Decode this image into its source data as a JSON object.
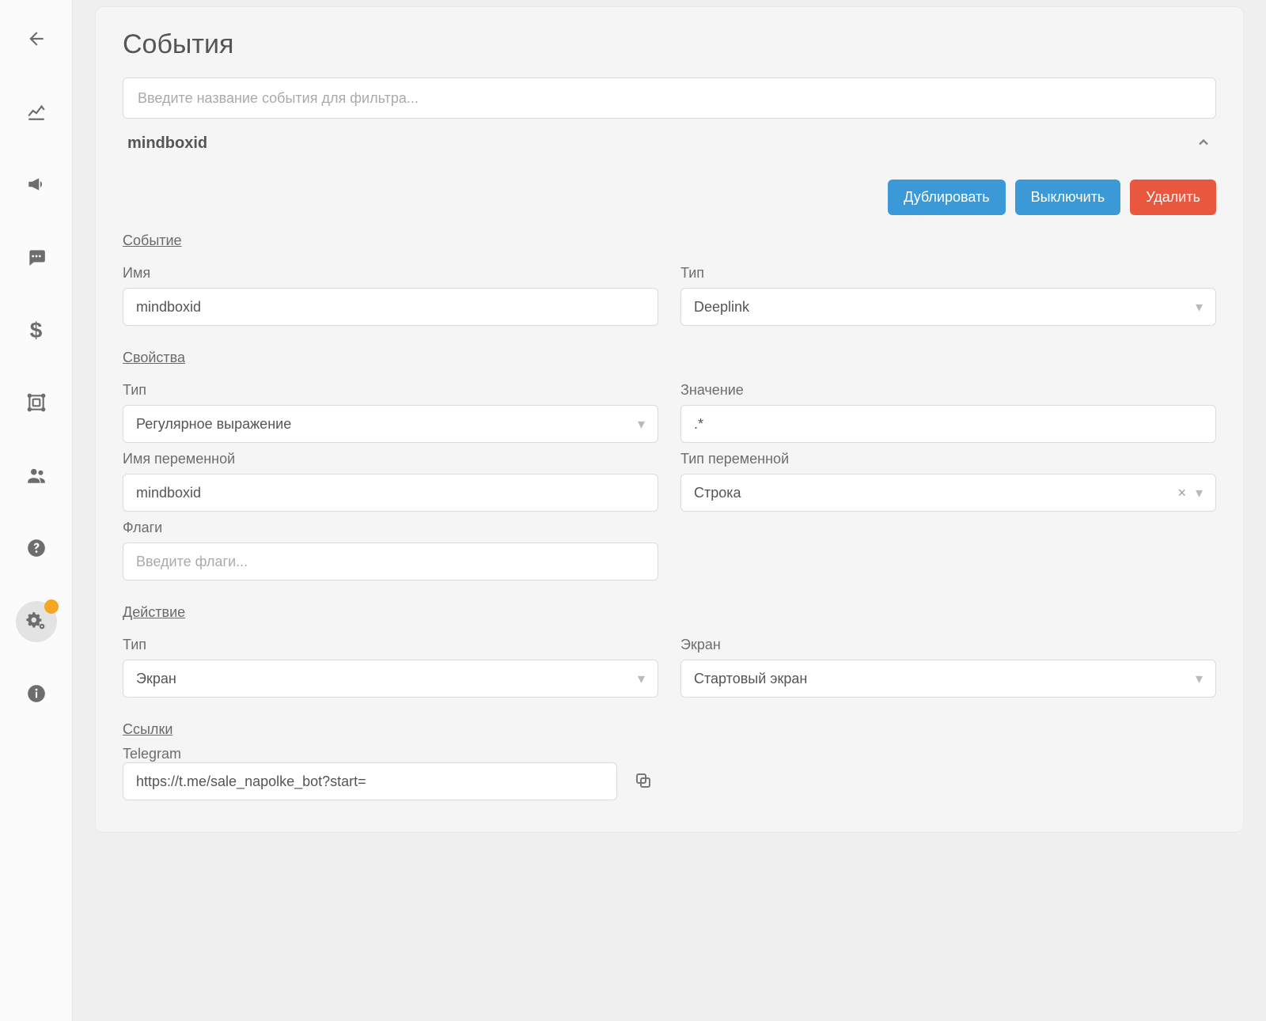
{
  "sidebar": {
    "items": [
      {
        "name": "back"
      },
      {
        "name": "analytics"
      },
      {
        "name": "campaigns"
      },
      {
        "name": "messages"
      },
      {
        "name": "billing"
      },
      {
        "name": "templates"
      },
      {
        "name": "audience"
      },
      {
        "name": "help"
      },
      {
        "name": "settings",
        "active": true,
        "badge": true
      },
      {
        "name": "info"
      }
    ]
  },
  "page": {
    "title": "События",
    "filter_placeholder": "Введите название события для фильтра..."
  },
  "event": {
    "name": "mindboxid",
    "buttons": {
      "duplicate": "Дублировать",
      "disable": "Выключить",
      "delete": "Удалить"
    },
    "sections": {
      "event": {
        "title": "Событие",
        "name_label": "Имя",
        "name_value": "mindboxid",
        "type_label": "Тип",
        "type_value": "Deeplink"
      },
      "properties": {
        "title": "Свойства",
        "type_label": "Тип",
        "type_value": "Регулярное выражение",
        "value_label": "Значение",
        "value_value": ".*",
        "var_name_label": "Имя переменной",
        "var_name_value": "mindboxid",
        "var_type_label": "Тип переменной",
        "var_type_value": "Строка",
        "flags_label": "Флаги",
        "flags_placeholder": "Введите флаги..."
      },
      "action": {
        "title": "Действие",
        "type_label": "Тип",
        "type_value": "Экран",
        "screen_label": "Экран",
        "screen_value": "Стартовый экран"
      },
      "links": {
        "title": "Ссылки",
        "telegram_label": "Telegram",
        "telegram_value": "https://t.me/sale_napolke_bot?start="
      }
    }
  }
}
